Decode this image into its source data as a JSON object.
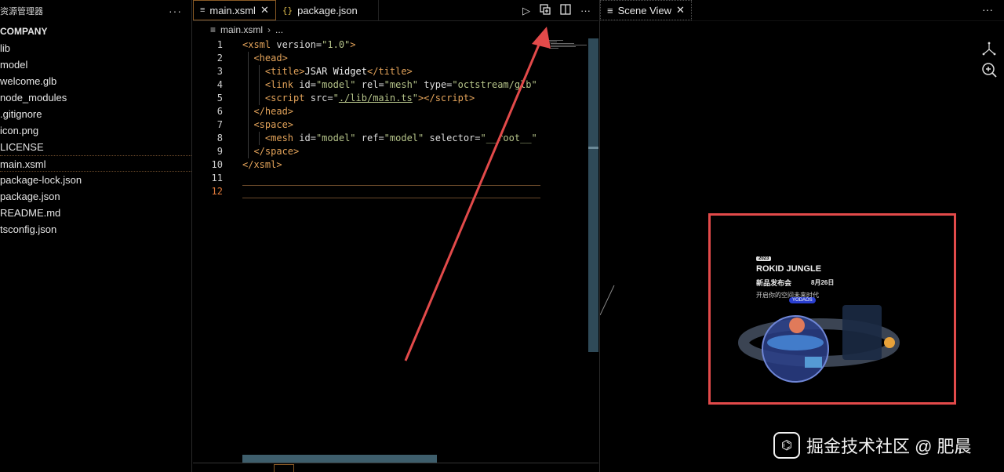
{
  "sidebar": {
    "title": "资源管理器",
    "more": "···",
    "root": "COMPANY",
    "items": [
      {
        "label": "lib"
      },
      {
        "label": "model"
      },
      {
        "label": "welcome.glb"
      },
      {
        "label": "node_modules"
      },
      {
        "label": ".gitignore"
      },
      {
        "label": "icon.png"
      },
      {
        "label": "LICENSE"
      },
      {
        "label": "main.xsml"
      },
      {
        "label": "package-lock.json"
      },
      {
        "label": "package.json"
      },
      {
        "label": "README.md"
      },
      {
        "label": "tsconfig.json"
      }
    ]
  },
  "editor": {
    "tabs": [
      {
        "label": "main.xsml",
        "icon": "lines-icon",
        "close": "✕"
      },
      {
        "label": "package.json",
        "icon": "json-braces-icon",
        "close": ""
      }
    ],
    "json_glyph": "{}",
    "actions": {
      "run": "▷",
      "more": "···"
    },
    "breadcrumb": {
      "file": "main.xsml",
      "sep": "›",
      "rest": "..."
    },
    "line_numbers": [
      "1",
      "2",
      "3",
      "4",
      "5",
      "6",
      "7",
      "8",
      "9",
      "10",
      "11",
      "12"
    ],
    "current_line": 12
  },
  "scene": {
    "tab_label": "Scene View",
    "close": "✕",
    "more": "···",
    "poster": {
      "badge": "2023",
      "title": "ROKID JUNGLE",
      "subtitle": "新品发布会",
      "date": "8月26日",
      "slogan": "开启你的空间未来时代",
      "pill": "YODAOS"
    }
  },
  "watermark": {
    "text": "掘金技术社区 @ 肥晨"
  },
  "colors": {
    "accent_orange": "#e07a3a",
    "annotation_red": "#e24a4a",
    "tag": "#e3a35a",
    "string": "#b6c48a",
    "scrollbar": "#2f4a58"
  }
}
